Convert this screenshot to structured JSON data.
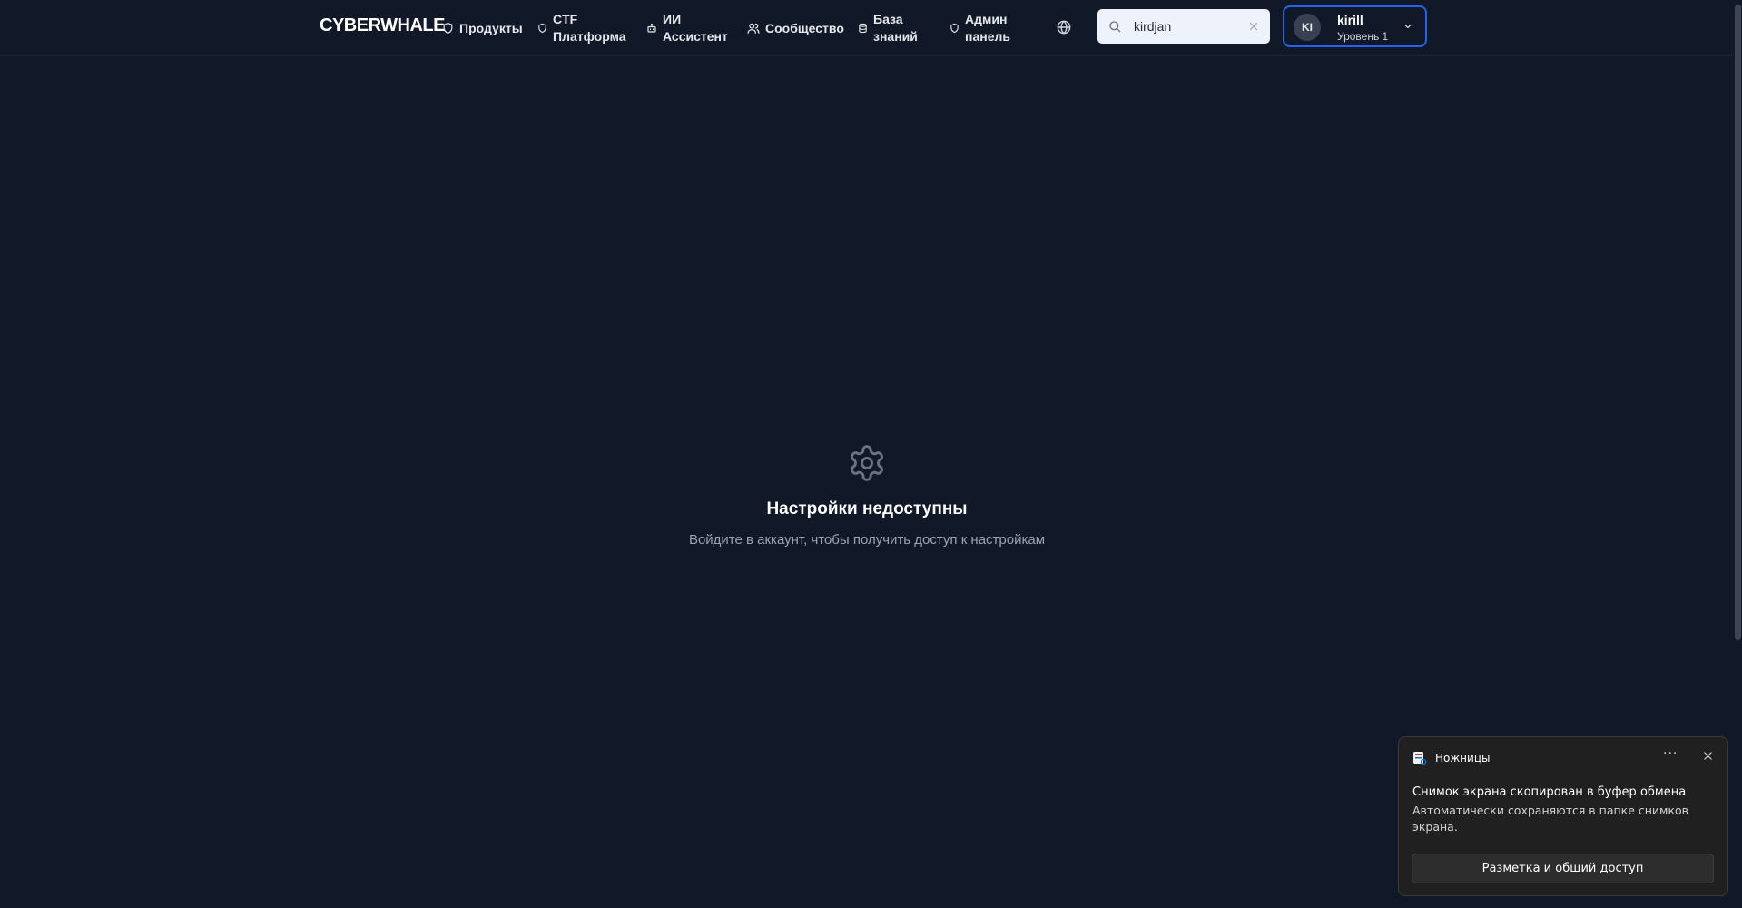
{
  "header": {
    "logo": "CYBERWHALE",
    "nav": [
      {
        "line1": "Продукты",
        "line2": "",
        "icon": "shield-icon"
      },
      {
        "line1": "CTF",
        "line2": "Платформа",
        "icon": "shield-icon"
      },
      {
        "line1": "ИИ",
        "line2": "Ассистент",
        "icon": "bot-icon"
      },
      {
        "line1": "Сообщество",
        "line2": "",
        "icon": "users-icon"
      },
      {
        "line1": "База",
        "line2": "знаний",
        "icon": "database-icon"
      },
      {
        "line1": "Админ",
        "line2": "панель",
        "icon": "shield-icon"
      }
    ],
    "search": {
      "value": "kirdjan"
    },
    "user": {
      "initials": "KI",
      "name": "kirill",
      "level": "Уровень 1"
    }
  },
  "main": {
    "icon": "gear-icon",
    "title": "Настройки недоступны",
    "subtitle": "Войдите в аккаунт, чтобы получить доступ к настройкам"
  },
  "toast": {
    "app_name": "Ножницы",
    "more": "···",
    "title": "Снимок экрана скопирован в буфер обмена",
    "body": "Автоматически сохраняются в папке снимков экрана.",
    "action": "Разметка и общий доступ"
  },
  "colors": {
    "background": "#111827",
    "accent_border": "#2563eb",
    "toast_background": "#202020"
  }
}
